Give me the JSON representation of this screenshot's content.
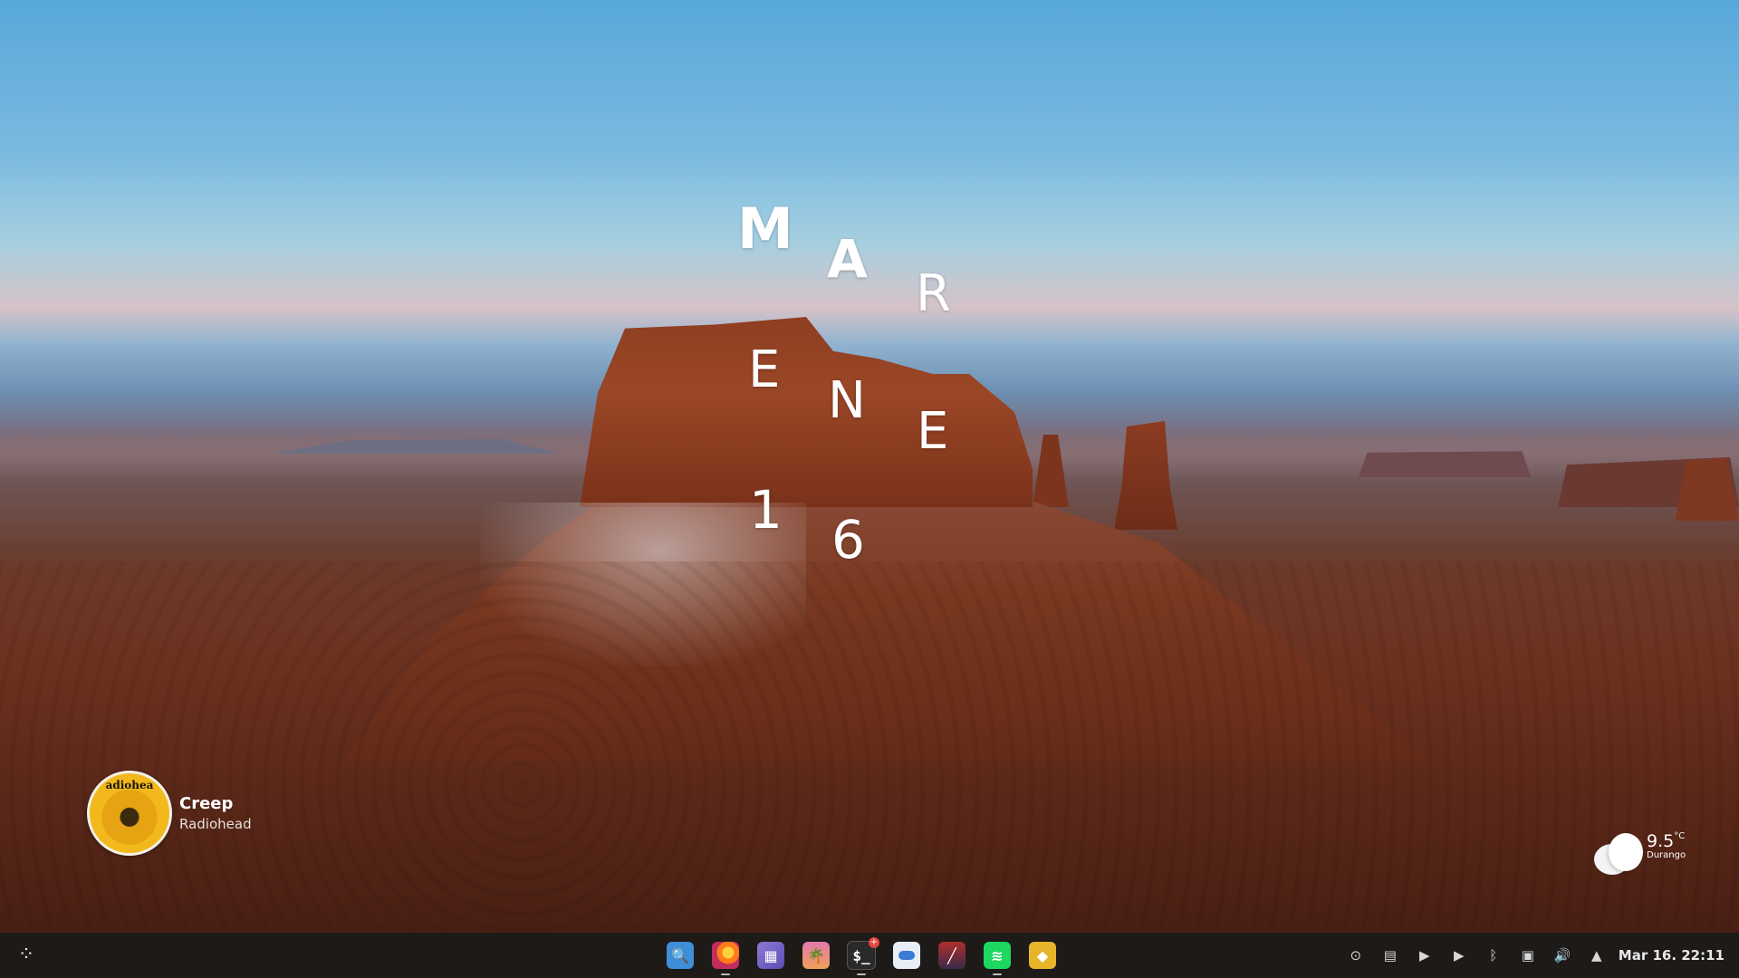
{
  "desktop": {
    "clock_letters": {
      "m": "M",
      "a": "A",
      "r": "R",
      "e1": "E",
      "n": "N",
      "e2": "E",
      "d1": "1",
      "d2": "6"
    }
  },
  "media": {
    "album_art_text": "adiohea",
    "title": "Creep",
    "artist": "Radiohead"
  },
  "weather": {
    "icon": "cloud-icon",
    "temperature": "9.5",
    "unit": "°C",
    "city": "Durango"
  },
  "taskbar": {
    "launcher_icon": "app-launcher-icon",
    "dock": [
      {
        "name": "files-icon",
        "glyph": "🔍",
        "running": false
      },
      {
        "name": "firefox-icon",
        "glyph": "",
        "running": true
      },
      {
        "name": "store-icon",
        "glyph": "▦",
        "running": false
      },
      {
        "name": "photos-icon",
        "glyph": "🌴",
        "running": false
      },
      {
        "name": "terminal-icon",
        "glyph": "$_",
        "running": true,
        "badge": "+"
      },
      {
        "name": "settings-toggle-icon",
        "glyph": "",
        "running": false
      },
      {
        "name": "fan-app-icon",
        "glyph": "╱",
        "running": false
      },
      {
        "name": "spotify-icon",
        "glyph": "≋",
        "running": true
      },
      {
        "name": "package-icon",
        "glyph": "◆",
        "running": false
      }
    ],
    "tray": [
      {
        "name": "accessibility-icon",
        "glyph": "⊙"
      },
      {
        "name": "clipboard-icon",
        "glyph": "▤"
      },
      {
        "name": "media-play-icon",
        "glyph": "▶"
      },
      {
        "name": "media-play-2-icon",
        "glyph": "▶"
      },
      {
        "name": "bluetooth-icon",
        "glyph": "ᛒ"
      },
      {
        "name": "display-icon",
        "glyph": "▣"
      },
      {
        "name": "volume-icon",
        "glyph": "🔊"
      },
      {
        "name": "tray-expand-icon",
        "glyph": "▲"
      }
    ],
    "datetime": "Mar 16. 22:11"
  }
}
